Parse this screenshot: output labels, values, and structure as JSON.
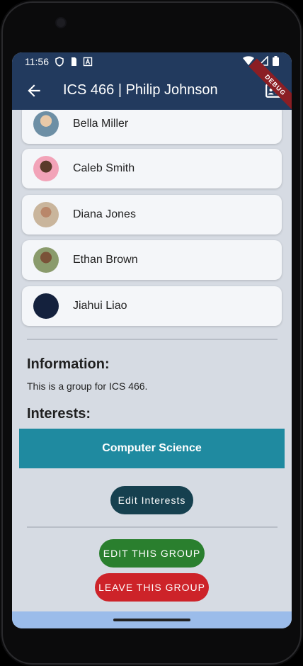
{
  "status_bar": {
    "time": "11:56",
    "left_icons": [
      "shield-icon",
      "sim-icon",
      "a-icon"
    ],
    "right_icons": [
      "wifi-icon",
      "signal-icon",
      "battery-icon"
    ],
    "debug_banner": "DEBUG"
  },
  "app_bar": {
    "title": "ICS 466 | Philip Johnson",
    "back_icon": "arrow-left-icon",
    "action_icon": "contact-card-icon",
    "color": "#223a5e"
  },
  "members": [
    {
      "name": "Bella Miller",
      "avatar_color": "#6d8fa5"
    },
    {
      "name": "Caleb Smith",
      "avatar_color": "#f2a3b8"
    },
    {
      "name": "Diana Jones",
      "avatar_color": "#c9b59c"
    },
    {
      "name": "Ethan Brown",
      "avatar_color": "#8a9b6c"
    },
    {
      "name": "Jiahui Liao",
      "avatar_color": "#14213d"
    }
  ],
  "information": {
    "heading": "Information:",
    "text": "This is a group for ICS 466."
  },
  "interests": {
    "heading": "Interests:",
    "items": [
      "Computer Science"
    ],
    "tile_color": "#1f8aa0"
  },
  "buttons": {
    "edit_interests": "Edit Interests",
    "edit_group": "EDIT THIS GROUP",
    "leave_group": "LEAVE THIS GROUP"
  }
}
